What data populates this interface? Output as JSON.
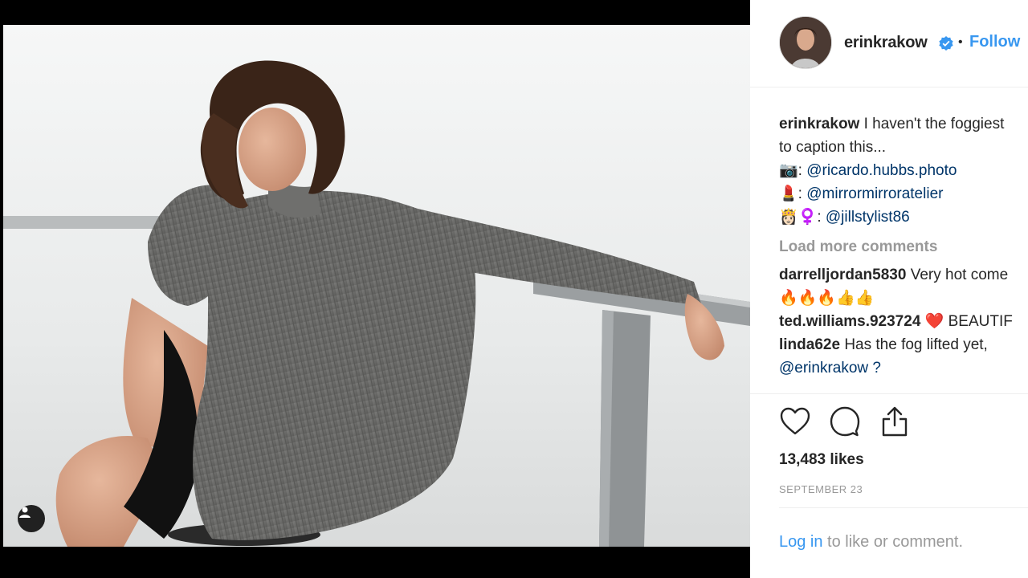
{
  "post": {
    "username": "erinkrakow",
    "separator": "•",
    "follow_label": "Follow",
    "verified_icon": "verified-badge-icon",
    "image_alt": "Woman with curly hair in an oversized grey knit sweater sitting against a railing in fog",
    "tag_icon": "user-tag-icon"
  },
  "caption": {
    "user": "erinkrakow",
    "text_line1": " I haven't the foggiest",
    "text_line2": "to caption this...",
    "credits": [
      {
        "emoji": "📷",
        "sep": ": ",
        "handle": "@ricardo.hubbs.photo"
      },
      {
        "emoji": "💄",
        "sep": ": ",
        "handle": "@mirrormirroratelier"
      },
      {
        "emoji": "👸🏻‍♀️",
        "sep": ": ",
        "handle": "@jillstylist86"
      }
    ]
  },
  "load_more_label": "Load more comments",
  "comments": [
    {
      "user": "darrelljordan5830",
      "text": " Very hot come",
      "text2": "🔥🔥🔥👍👍"
    },
    {
      "user": "ted.williams.923724",
      "text": " ❤️ BEAUTIF"
    },
    {
      "user": "linda62e",
      "text": " Has the fog lifted yet,",
      "mention": "@erinkrakow ?"
    }
  ],
  "actions": {
    "like_icon": "heart-icon",
    "comment_icon": "comment-icon",
    "share_icon": "share-icon"
  },
  "likes": "13,483 likes",
  "date": "SEPTEMBER 23",
  "login": {
    "link": "Log in",
    "rest": " to like or comment."
  },
  "colors": {
    "accent": "#3897f0",
    "text": "#262626",
    "muted": "#999999",
    "link": "#003569"
  }
}
